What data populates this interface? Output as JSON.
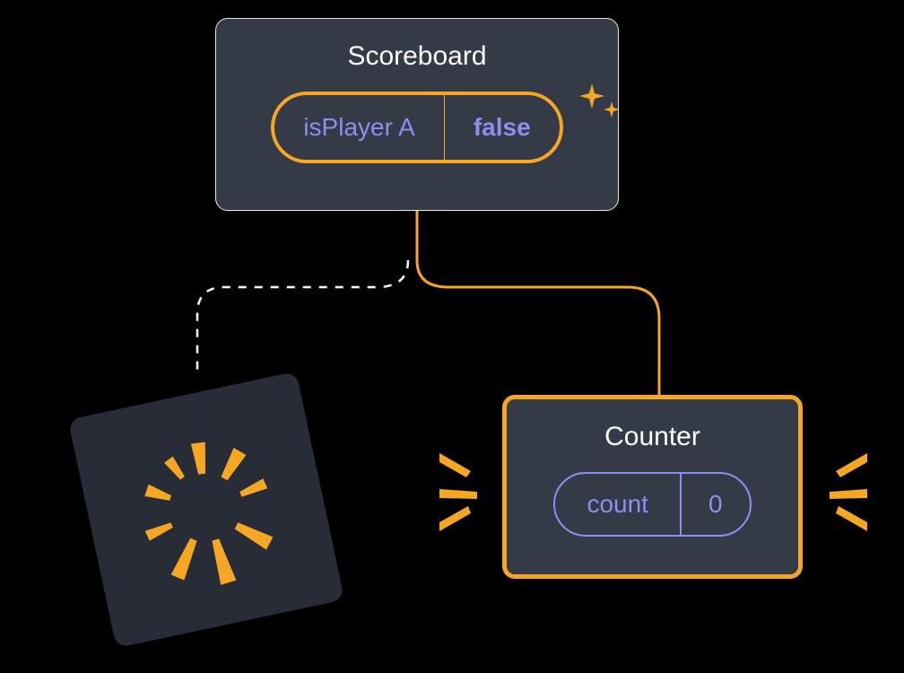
{
  "scoreboard": {
    "title": "Scoreboard",
    "prop_name": "isPlayer A",
    "prop_value": "false"
  },
  "counter": {
    "title": "Counter",
    "state_name": "count",
    "state_value": "0"
  },
  "colors": {
    "accent": "#f5a623",
    "box_bg": "#343a46",
    "text_light": "#fff",
    "text_purple": "#8b8ff0"
  }
}
